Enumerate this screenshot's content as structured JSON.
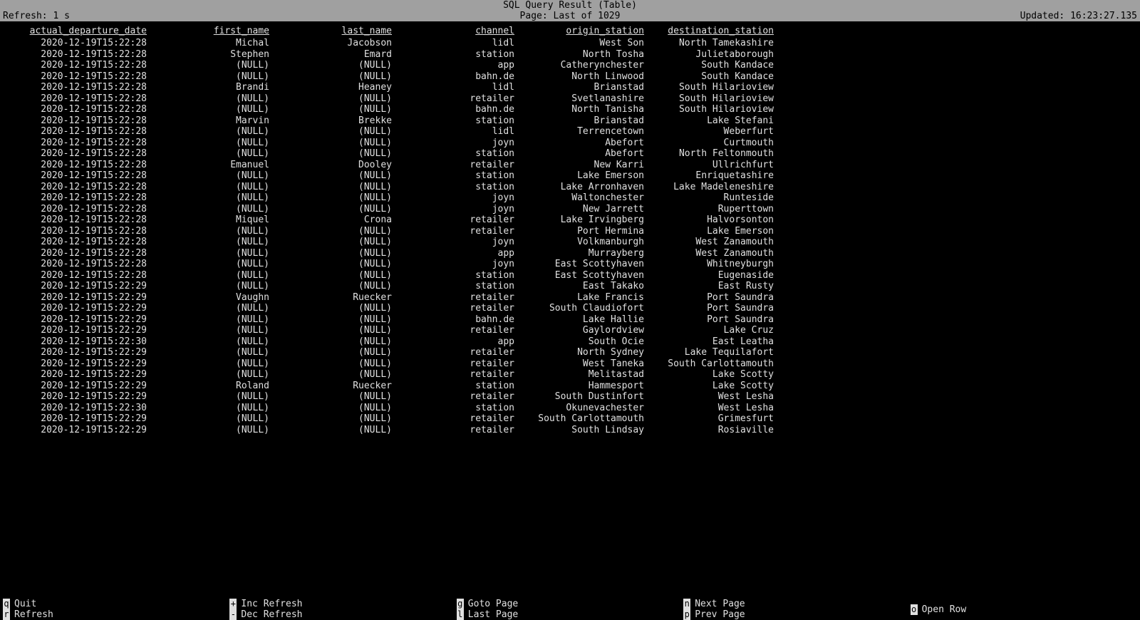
{
  "header": {
    "title": "SQL Query Result (Table)",
    "refresh": "Refresh: 1 s",
    "page": "Page: Last of 1029",
    "updated": "Updated: 16:23:27.135"
  },
  "columns": [
    "actual_departure_date",
    "first_name",
    "last_name",
    "channel",
    "origin_station",
    "destination_station"
  ],
  "rows": [
    {
      "date": "2020-12-19T15:22:28",
      "fn": "Michal",
      "ln": "Jacobson",
      "ch": "lidl",
      "os": "West Son",
      "ds": "North Tamekashire"
    },
    {
      "date": "2020-12-19T15:22:28",
      "fn": "Stephen",
      "ln": "Emard",
      "ch": "station",
      "os": "North Tosha",
      "ds": "Julietaborough"
    },
    {
      "date": "2020-12-19T15:22:28",
      "fn": "(NULL)",
      "ln": "(NULL)",
      "ch": "app",
      "os": "Catherynchester",
      "ds": "South Kandace"
    },
    {
      "date": "2020-12-19T15:22:28",
      "fn": "(NULL)",
      "ln": "(NULL)",
      "ch": "bahn.de",
      "os": "North Linwood",
      "ds": "South Kandace"
    },
    {
      "date": "2020-12-19T15:22:28",
      "fn": "Brandi",
      "ln": "Heaney",
      "ch": "lidl",
      "os": "Brianstad",
      "ds": "South Hilarioview"
    },
    {
      "date": "2020-12-19T15:22:28",
      "fn": "(NULL)",
      "ln": "(NULL)",
      "ch": "retailer",
      "os": "Svetlanashire",
      "ds": "South Hilarioview"
    },
    {
      "date": "2020-12-19T15:22:28",
      "fn": "(NULL)",
      "ln": "(NULL)",
      "ch": "bahn.de",
      "os": "North Tanisha",
      "ds": "South Hilarioview"
    },
    {
      "date": "2020-12-19T15:22:28",
      "fn": "Marvin",
      "ln": "Brekke",
      "ch": "station",
      "os": "Brianstad",
      "ds": "Lake Stefani"
    },
    {
      "date": "2020-12-19T15:22:28",
      "fn": "(NULL)",
      "ln": "(NULL)",
      "ch": "lidl",
      "os": "Terrencetown",
      "ds": "Weberfurt"
    },
    {
      "date": "2020-12-19T15:22:28",
      "fn": "(NULL)",
      "ln": "(NULL)",
      "ch": "joyn",
      "os": "Abefort",
      "ds": "Curtmouth"
    },
    {
      "date": "2020-12-19T15:22:28",
      "fn": "(NULL)",
      "ln": "(NULL)",
      "ch": "station",
      "os": "Abefort",
      "ds": "North Feltonmouth"
    },
    {
      "date": "2020-12-19T15:22:28",
      "fn": "Emanuel",
      "ln": "Dooley",
      "ch": "retailer",
      "os": "New Karri",
      "ds": "Ullrichfurt"
    },
    {
      "date": "2020-12-19T15:22:28",
      "fn": "(NULL)",
      "ln": "(NULL)",
      "ch": "station",
      "os": "Lake Emerson",
      "ds": "Enriquetashire"
    },
    {
      "date": "2020-12-19T15:22:28",
      "fn": "(NULL)",
      "ln": "(NULL)",
      "ch": "station",
      "os": "Lake Arronhaven",
      "ds": "Lake Madeleneshire"
    },
    {
      "date": "2020-12-19T15:22:28",
      "fn": "(NULL)",
      "ln": "(NULL)",
      "ch": "joyn",
      "os": "Waltonchester",
      "ds": "Runteside"
    },
    {
      "date": "2020-12-19T15:22:28",
      "fn": "(NULL)",
      "ln": "(NULL)",
      "ch": "joyn",
      "os": "New Jarrett",
      "ds": "Ruperttown"
    },
    {
      "date": "2020-12-19T15:22:28",
      "fn": "Miquel",
      "ln": "Crona",
      "ch": "retailer",
      "os": "Lake Irvingberg",
      "ds": "Halvorsonton"
    },
    {
      "date": "2020-12-19T15:22:28",
      "fn": "(NULL)",
      "ln": "(NULL)",
      "ch": "retailer",
      "os": "Port Hermina",
      "ds": "Lake Emerson"
    },
    {
      "date": "2020-12-19T15:22:28",
      "fn": "(NULL)",
      "ln": "(NULL)",
      "ch": "joyn",
      "os": "Volkmanburgh",
      "ds": "West Zanamouth"
    },
    {
      "date": "2020-12-19T15:22:28",
      "fn": "(NULL)",
      "ln": "(NULL)",
      "ch": "app",
      "os": "Murrayberg",
      "ds": "West Zanamouth"
    },
    {
      "date": "2020-12-19T15:22:28",
      "fn": "(NULL)",
      "ln": "(NULL)",
      "ch": "joyn",
      "os": "East Scottyhaven",
      "ds": "Whitneyburgh"
    },
    {
      "date": "2020-12-19T15:22:28",
      "fn": "(NULL)",
      "ln": "(NULL)",
      "ch": "station",
      "os": "East Scottyhaven",
      "ds": "Eugenaside"
    },
    {
      "date": "2020-12-19T15:22:29",
      "fn": "(NULL)",
      "ln": "(NULL)",
      "ch": "station",
      "os": "East Takako",
      "ds": "East Rusty"
    },
    {
      "date": "2020-12-19T15:22:29",
      "fn": "Vaughn",
      "ln": "Ruecker",
      "ch": "retailer",
      "os": "Lake Francis",
      "ds": "Port Saundra"
    },
    {
      "date": "2020-12-19T15:22:29",
      "fn": "(NULL)",
      "ln": "(NULL)",
      "ch": "retailer",
      "os": "South Claudiofort",
      "ds": "Port Saundra"
    },
    {
      "date": "2020-12-19T15:22:29",
      "fn": "(NULL)",
      "ln": "(NULL)",
      "ch": "bahn.de",
      "os": "Lake Hallie",
      "ds": "Port Saundra"
    },
    {
      "date": "2020-12-19T15:22:29",
      "fn": "(NULL)",
      "ln": "(NULL)",
      "ch": "retailer",
      "os": "Gaylordview",
      "ds": "Lake Cruz"
    },
    {
      "date": "2020-12-19T15:22:30",
      "fn": "(NULL)",
      "ln": "(NULL)",
      "ch": "app",
      "os": "South Ocie",
      "ds": "East Leatha"
    },
    {
      "date": "2020-12-19T15:22:29",
      "fn": "(NULL)",
      "ln": "(NULL)",
      "ch": "retailer",
      "os": "North Sydney",
      "ds": "Lake Tequilafort"
    },
    {
      "date": "2020-12-19T15:22:29",
      "fn": "(NULL)",
      "ln": "(NULL)",
      "ch": "retailer",
      "os": "West Taneka",
      "ds": "South Carlottamouth"
    },
    {
      "date": "2020-12-19T15:22:29",
      "fn": "(NULL)",
      "ln": "(NULL)",
      "ch": "retailer",
      "os": "Melitastad",
      "ds": "Lake Scotty"
    },
    {
      "date": "2020-12-19T15:22:29",
      "fn": "Roland",
      "ln": "Ruecker",
      "ch": "station",
      "os": "Hammesport",
      "ds": "Lake Scotty"
    },
    {
      "date": "2020-12-19T15:22:29",
      "fn": "(NULL)",
      "ln": "(NULL)",
      "ch": "retailer",
      "os": "South Dustinfort",
      "ds": "West Lesha"
    },
    {
      "date": "2020-12-19T15:22:30",
      "fn": "(NULL)",
      "ln": "(NULL)",
      "ch": "station",
      "os": "Okunevachester",
      "ds": "West Lesha"
    },
    {
      "date": "2020-12-19T15:22:29",
      "fn": "(NULL)",
      "ln": "(NULL)",
      "ch": "retailer",
      "os": "South Carlottamouth",
      "ds": "Grimesfurt"
    },
    {
      "date": "2020-12-19T15:22:29",
      "fn": "(NULL)",
      "ln": "(NULL)",
      "ch": "retailer",
      "os": "South Lindsay",
      "ds": "Rosiaville"
    }
  ],
  "footer": [
    [
      {
        "key": "q",
        "label": "Quit"
      },
      {
        "key": "r",
        "label": "Refresh"
      }
    ],
    [
      {
        "key": "+",
        "label": "Inc Refresh"
      },
      {
        "key": "-",
        "label": "Dec Refresh"
      }
    ],
    [
      {
        "key": "g",
        "label": "Goto Page"
      },
      {
        "key": "l",
        "label": "Last Page"
      }
    ],
    [
      {
        "key": "n",
        "label": "Next Page"
      },
      {
        "key": "p",
        "label": "Prev Page"
      }
    ],
    [
      {
        "key": "o",
        "label": "Open Row"
      }
    ]
  ]
}
